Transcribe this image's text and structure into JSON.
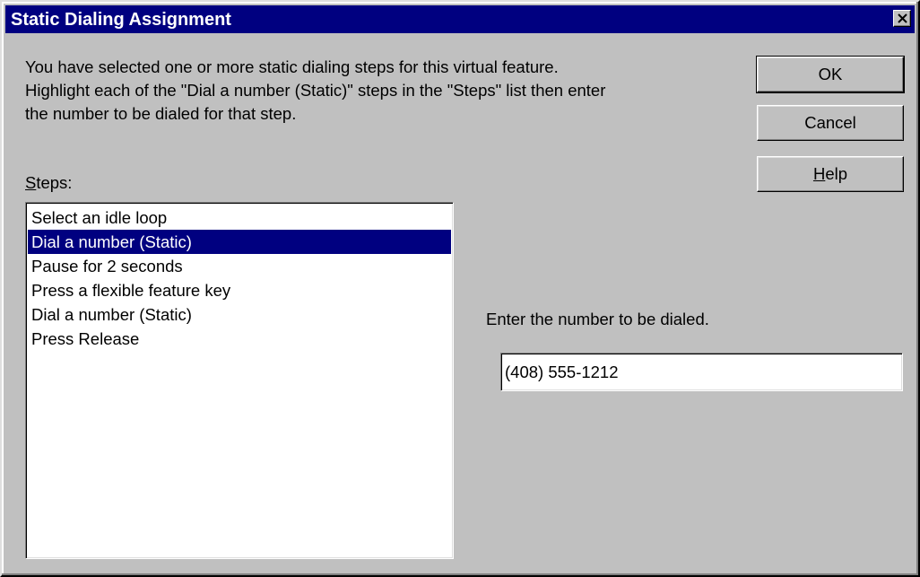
{
  "window": {
    "title": "Static Dialing Assignment",
    "close_icon": "close-icon"
  },
  "instructions": {
    "line1": "You have selected one or more static dialing steps for this virtual feature.",
    "line2": "Highlight each of the \"Dial a number (Static)\" steps in the \"Steps\" list then enter",
    "line3": "the number to be dialed for that step."
  },
  "buttons": {
    "ok": "OK",
    "cancel": "Cancel",
    "help_mnemonic": "H",
    "help_rest": "elp"
  },
  "steps": {
    "label_mnemonic": "S",
    "label_rest": "teps:",
    "selected_index": 1,
    "items": [
      "Select an idle loop",
      "Dial a number (Static)",
      "Pause for 2 seconds",
      "Press a flexible feature key",
      "Dial a number (Static)",
      "Press Release"
    ]
  },
  "dial": {
    "label": "Enter the number to be dialed.",
    "value": "(408) 555-1212"
  },
  "colors": {
    "titlebar": "#000080",
    "face": "#c0c0c0",
    "selection": "#000080"
  }
}
